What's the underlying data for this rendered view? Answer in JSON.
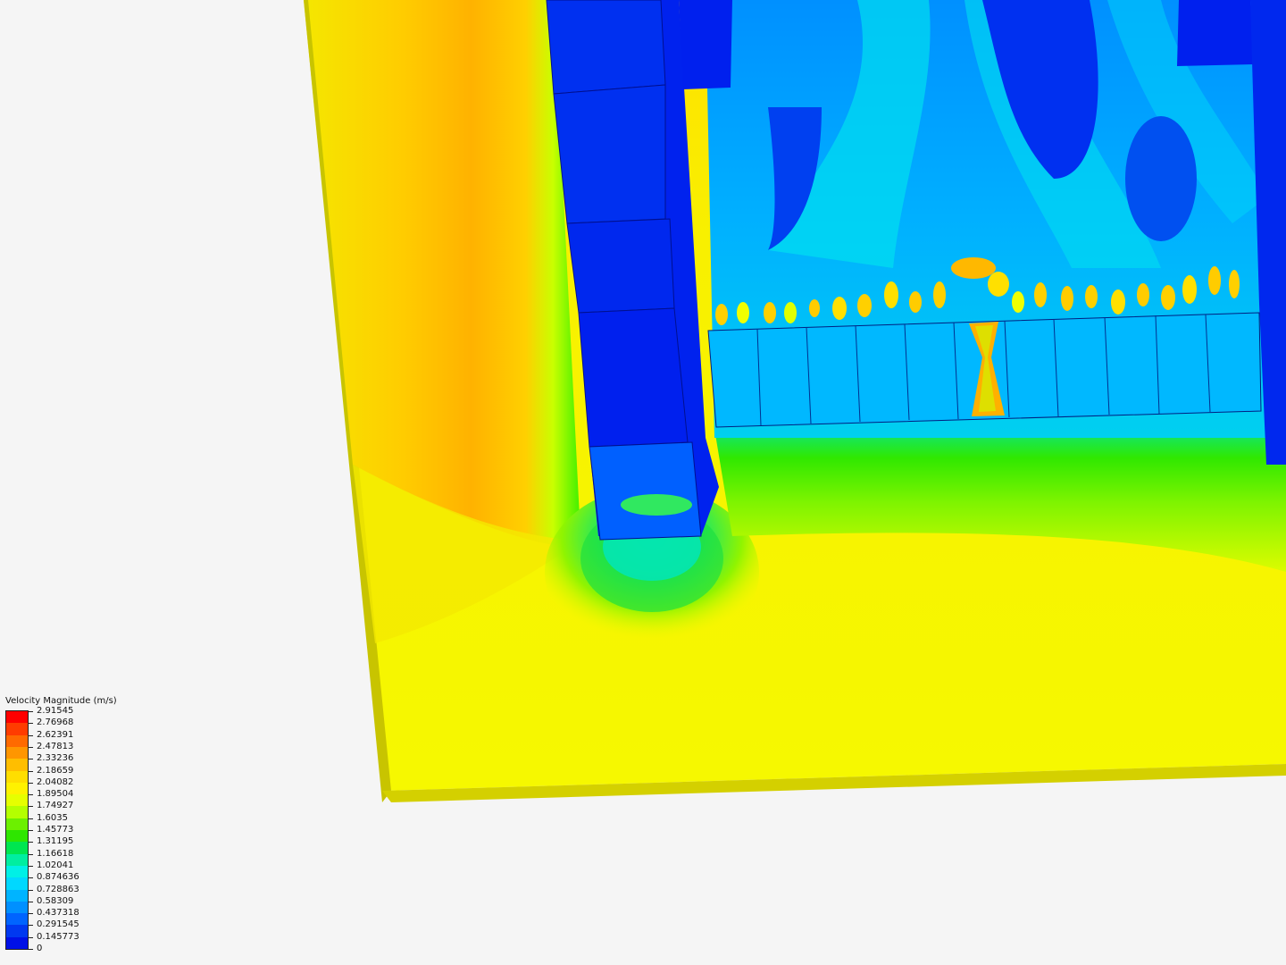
{
  "legend": {
    "title": "Velocity Magnitude (m/s)",
    "values": [
      "2.91545",
      "2.76968",
      "2.62391",
      "2.47813",
      "2.33236",
      "2.18659",
      "2.04082",
      "1.89504",
      "1.74927",
      "1.6035",
      "1.45773",
      "1.31195",
      "1.16618",
      "1.02041",
      "0.874636",
      "0.728863",
      "0.58309",
      "0.437318",
      "0.291545",
      "0.145773",
      "0"
    ],
    "colors": [
      "#ff0000",
      "#ff3c00",
      "#ff6a00",
      "#ff9600",
      "#ffbe00",
      "#ffde00",
      "#fff200",
      "#e6ff00",
      "#b4ff00",
      "#6cf000",
      "#2ee600",
      "#00e650",
      "#00eea0",
      "#00f0e6",
      "#00d8ff",
      "#00b4ff",
      "#0090ff",
      "#0064ff",
      "#0038f0",
      "#0010e6"
    ]
  },
  "field_colors": {
    "background": "#f5f5f5",
    "plate_top": "#f2f000",
    "plate_edge": "#c8c400",
    "solid_blue": "#0022ee",
    "inlet_orange": "#ffb000",
    "inlet_yellow": "#ffd800"
  }
}
